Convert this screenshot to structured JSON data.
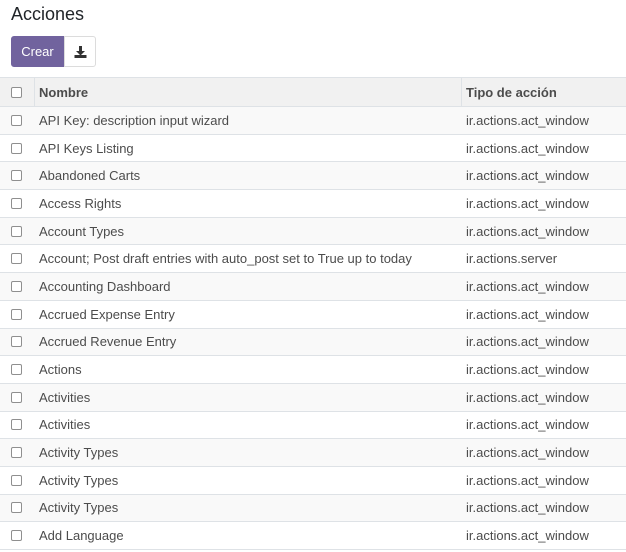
{
  "page": {
    "title": "Acciones"
  },
  "toolbar": {
    "create_label": "Crear",
    "download_icon": "download-icon"
  },
  "table": {
    "columns": [
      "Nombre",
      "Tipo de acción"
    ],
    "rows": [
      {
        "name": "API Key: description input wizard",
        "type": "ir.actions.act_window"
      },
      {
        "name": "API Keys Listing",
        "type": "ir.actions.act_window"
      },
      {
        "name": "Abandoned Carts",
        "type": "ir.actions.act_window"
      },
      {
        "name": "Access Rights",
        "type": "ir.actions.act_window"
      },
      {
        "name": "Account Types",
        "type": "ir.actions.act_window"
      },
      {
        "name": "Account; Post draft entries with auto_post set to True up to today",
        "type": "ir.actions.server"
      },
      {
        "name": "Accounting Dashboard",
        "type": "ir.actions.act_window"
      },
      {
        "name": "Accrued Expense Entry",
        "type": "ir.actions.act_window"
      },
      {
        "name": "Accrued Revenue Entry",
        "type": "ir.actions.act_window"
      },
      {
        "name": "Actions",
        "type": "ir.actions.act_window"
      },
      {
        "name": "Activities",
        "type": "ir.actions.act_window"
      },
      {
        "name": "Activities",
        "type": "ir.actions.act_window"
      },
      {
        "name": "Activity Types",
        "type": "ir.actions.act_window"
      },
      {
        "name": "Activity Types",
        "type": "ir.actions.act_window"
      },
      {
        "name": "Activity Types",
        "type": "ir.actions.act_window"
      },
      {
        "name": "Add Language",
        "type": "ir.actions.act_window"
      }
    ]
  },
  "colors": {
    "primary": "#71639e",
    "header_bg": "#f1f1f1",
    "row_alt_bg": "#f9f9f9",
    "border": "#dee2e6"
  }
}
